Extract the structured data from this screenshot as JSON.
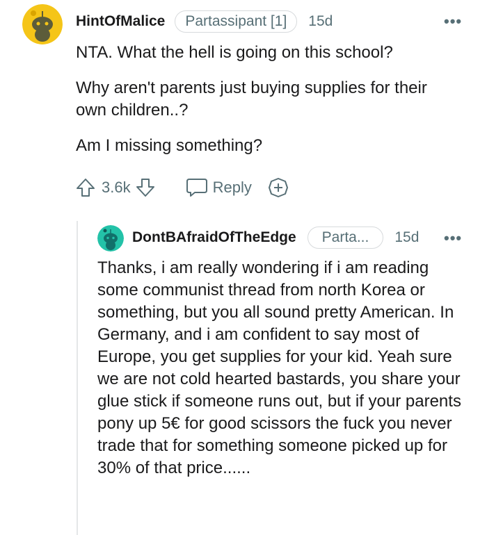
{
  "comment": {
    "username": "HintOfMalice",
    "flair": "Partassipant [1]",
    "time": "15d",
    "more": "•••",
    "paragraphs": [
      "NTA. What the hell is going on this school?",
      "Why aren't parents just buying supplies for their own children..?",
      "Am I missing something?"
    ],
    "votes": "3.6k",
    "reply_label": "Reply"
  },
  "reply": {
    "username": "DontBAfraidOfTheEdge",
    "flair": "Parta...",
    "time": "15d",
    "more": "•••",
    "text": "Thanks, i am really wondering if i am reading some communist thread from north Korea or something, but you all sound pretty American. In Germany, and i am confident to say most of Europe, you get supplies for your kid. Yeah sure we are not cold hearted bastards, you share your glue stick if someone runs out, but if your parents pony up 5€ for good scissors the fuck you never trade that for something someone picked up for 30% of that price......"
  },
  "colors": {
    "avatar1_bg": "#f5c518",
    "avatar2_bg": "#23c2a8",
    "muted": "#576f76"
  },
  "icons": [
    "snoo-avatar-icon",
    "upvote-icon",
    "downvote-icon",
    "reply-bubble-icon",
    "award-icon",
    "more-options-icon"
  ]
}
